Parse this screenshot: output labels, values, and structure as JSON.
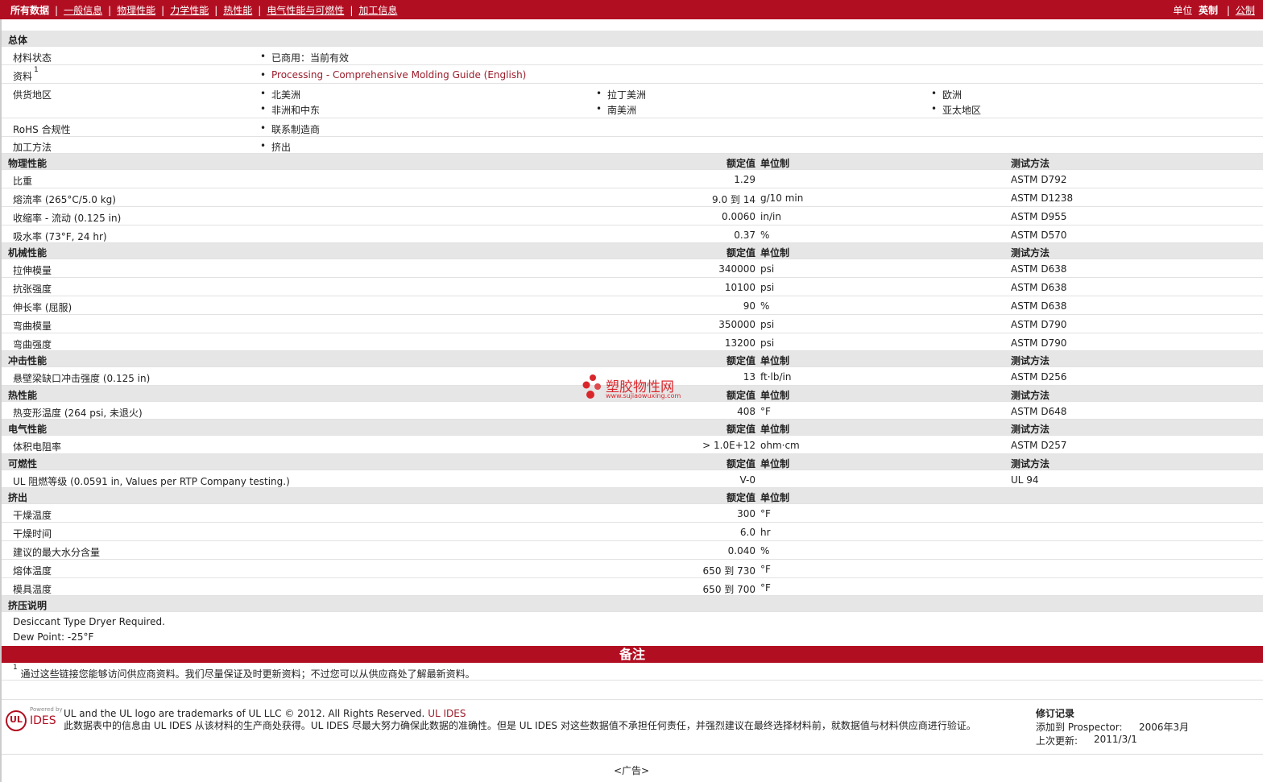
{
  "nav": {
    "items": [
      "所有数据",
      "一般信息",
      "物理性能",
      "力学性能",
      "热性能",
      "电气性能与可燃性",
      "加工信息"
    ],
    "units_label": "单位",
    "units_active": "英制",
    "units_other": "公制"
  },
  "general": {
    "title": "总体",
    "material_status": {
      "label": "材料状态",
      "value": "已商用：当前有效"
    },
    "docs": {
      "label": "资料",
      "sup": "1",
      "value": "Processing - Comprehensive Molding Guide (English)"
    },
    "regions": {
      "label": "供货地区",
      "values": [
        "北美洲",
        "拉丁美洲",
        "欧洲",
        "非洲和中东",
        "南美洲",
        "亚太地区"
      ]
    },
    "rohs": {
      "label": "RoHS 合规性",
      "value": "联系制造商"
    },
    "process": {
      "label": "加工方法",
      "value": "挤出"
    }
  },
  "col_headers": {
    "nominal": "额定值",
    "unit": "单位制",
    "test": "测试方法"
  },
  "physical": {
    "title": "物理性能",
    "rows": [
      {
        "label": "比重",
        "value": "1.29",
        "unit": "",
        "test": "ASTM D792"
      },
      {
        "label": "熔流率 (265°C/5.0 kg)",
        "value": "9.0 到 14",
        "unit": "g/10 min",
        "test": "ASTM D1238"
      },
      {
        "label": "收缩率 - 流动 (0.125 in)",
        "value": "0.0060",
        "unit": "in/in",
        "test": "ASTM D955"
      },
      {
        "label": "吸水率 (73°F, 24 hr)",
        "value": "0.37",
        "unit": "%",
        "test": "ASTM D570"
      }
    ]
  },
  "mechanical": {
    "title": "机械性能",
    "rows": [
      {
        "label": "拉伸模量",
        "value": "340000",
        "unit": "psi",
        "test": "ASTM D638"
      },
      {
        "label": "抗张强度",
        "value": "10100",
        "unit": "psi",
        "test": "ASTM D638"
      },
      {
        "label": "伸长率 (屈服)",
        "value": "90",
        "unit": "%",
        "test": "ASTM D638"
      },
      {
        "label": "弯曲模量",
        "value": "350000",
        "unit": "psi",
        "test": "ASTM D790"
      },
      {
        "label": "弯曲强度",
        "value": "13200",
        "unit": "psi",
        "test": "ASTM D790"
      }
    ]
  },
  "impact": {
    "title": "冲击性能",
    "rows": [
      {
        "label": "悬壁梁缺口冲击强度 (0.125 in)",
        "value": "13",
        "unit": "ft·lb/in",
        "test": "ASTM D256"
      }
    ]
  },
  "thermal": {
    "title": "热性能",
    "rows": [
      {
        "label": "热变形温度 (264 psi, 未退火)",
        "value": "408",
        "unit": "°F",
        "test": "ASTM D648"
      }
    ]
  },
  "electrical": {
    "title": "电气性能",
    "rows": [
      {
        "label": "体积电阻率",
        "value": "> 1.0E+12",
        "unit": "ohm·cm",
        "test": "ASTM D257"
      }
    ]
  },
  "flammability": {
    "title": "可燃性",
    "rows": [
      {
        "label": "UL 阻燃等级 (0.0591 in, Values per RTP Company testing.)",
        "value": "V-0",
        "unit": "",
        "test": "UL 94"
      }
    ]
  },
  "extrusion": {
    "title": "挤出",
    "rows": [
      {
        "label": "干燥温度",
        "value": "300",
        "unit": "°F"
      },
      {
        "label": "干燥时间",
        "value": "6.0",
        "unit": "hr"
      },
      {
        "label": "建议的最大水分含量",
        "value": "0.040",
        "unit": "%"
      },
      {
        "label": "熔体温度",
        "value": "650 到 730",
        "unit": "°F"
      },
      {
        "label": "模具温度",
        "value": "650 到 700",
        "unit": "°F"
      }
    ]
  },
  "extrusion_notes": {
    "title": "挤压说明",
    "lines": [
      "Desiccant Type Dryer Required.",
      "Dew Point: -25°F"
    ]
  },
  "notes": {
    "title": "备注",
    "sup": "1",
    "text": "通过这些链接您能够访问供应商资料。我们尽量保证及时更新资料；不过您可以从供应商处了解最新资料。"
  },
  "watermark": {
    "name": "塑胶物性网",
    "url": "www.sujiaowuxing.com"
  },
  "footer": {
    "logo_powered": "Powered by",
    "logo_ul": "UL",
    "logo_ides": "IDES",
    "trademark_pre": "UL and the UL logo are trademarks of UL LLC © 2012. All Rights Reserved.",
    "trademark_link": "UL IDES",
    "disclaimer": "此数据表中的信息由 UL IDES 从该材料的生产商处获得。UL IDES 尽最大努力确保此数据的准确性。但是 UL IDES 对这些数据值不承担任何责任，并强烈建议在最终选择材料前，就数据值与材料供应商进行验证。",
    "revision_title": "修订记录",
    "added_label": "添加到 Prospector:",
    "added_value": "2006年3月",
    "updated_label": "上次更新:",
    "updated_value": "2011/3/1"
  },
  "ad": "<广告>"
}
